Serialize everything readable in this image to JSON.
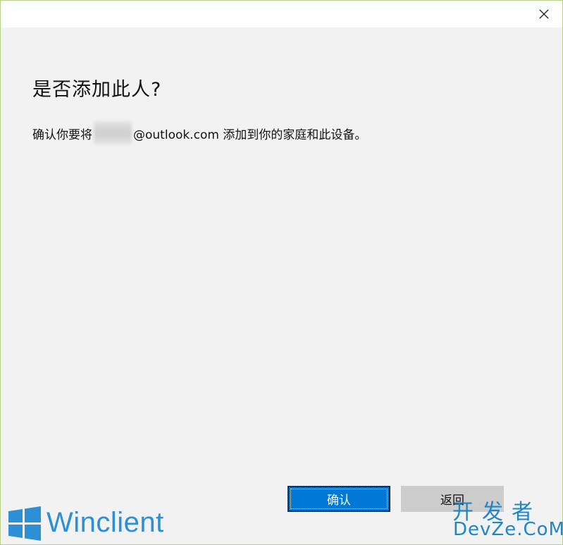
{
  "dialog": {
    "heading": "是否添加此人?",
    "message_prefix": "确认你要将",
    "message_suffix": "@outlook.com 添加到你的家庭和此设备。"
  },
  "buttons": {
    "confirm_label": "确认",
    "back_label": "返回"
  },
  "titlebar": {
    "close_icon": "close-icon"
  },
  "watermarks": {
    "winclient_text": "Winclient",
    "devze_cn": "开发者",
    "devze_en": "DevZe.CoM"
  },
  "colors": {
    "accent": "#0078d7",
    "secondary_button": "#cccccc",
    "background": "#f2f2f2"
  }
}
